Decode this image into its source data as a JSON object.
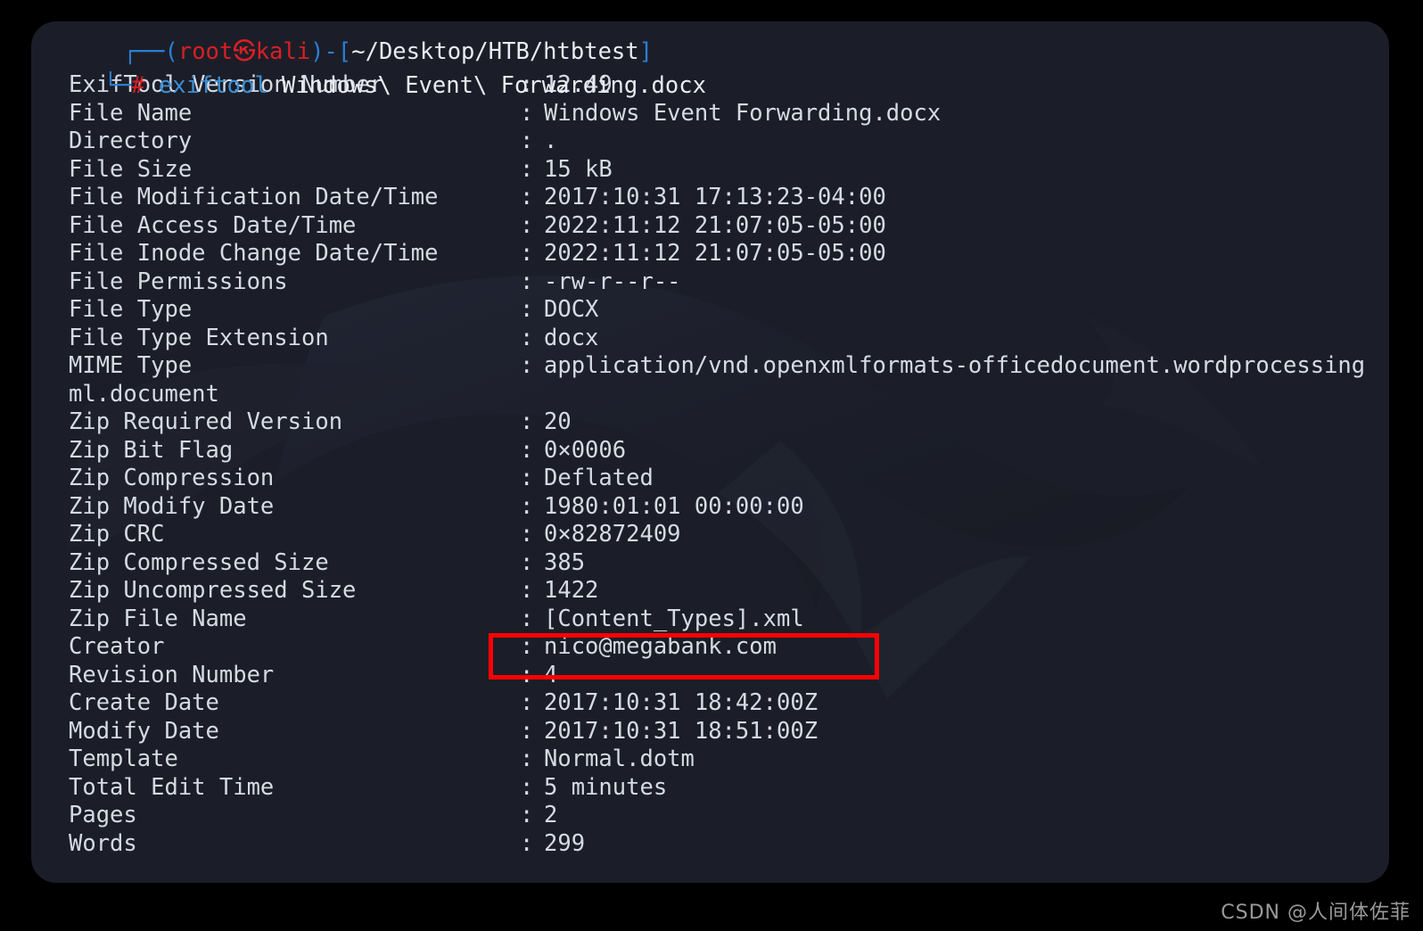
{
  "window": {
    "background_color": "#1b1e28",
    "page_background_color": "#000000",
    "text_color": "#d6dae3",
    "accent_red": "#fe0000",
    "prompt_red": "#d81f25",
    "prompt_blue": "#2a7fd4"
  },
  "prompt": {
    "clipped_line": "┌──(root㉿kali)-[~/Desktop/HTB/htbtest]",
    "user_host": "root㉿kali",
    "path": "~/Desktop/HTB/htbtest",
    "connector": "└─",
    "symbol": "#",
    "command_name": "exiftool",
    "command_args": "Windows\\ Event\\ Forwarding.docx",
    "full_command": "exiftool Windows\\ Event\\ Forwarding.docx"
  },
  "output": {
    "separator": ":",
    "rows": [
      {
        "key": "ExifTool Version Number",
        "value": "12.49"
      },
      {
        "key": "File Name",
        "value": "Windows Event Forwarding.docx"
      },
      {
        "key": "Directory",
        "value": "."
      },
      {
        "key": "File Size",
        "value": "15 kB"
      },
      {
        "key": "File Modification Date/Time",
        "value": "2017:10:31 17:13:23-04:00"
      },
      {
        "key": "File Access Date/Time",
        "value": "2022:11:12 21:07:05-05:00"
      },
      {
        "key": "File Inode Change Date/Time",
        "value": "2022:11:12 21:07:05-05:00"
      },
      {
        "key": "File Permissions",
        "value": "-rw-r--r--"
      },
      {
        "key": "File Type",
        "value": "DOCX"
      },
      {
        "key": "File Type Extension",
        "value": "docx"
      },
      {
        "key": "MIME Type",
        "value": "application/vnd.openxmlformats-officedocument.wordprocessing",
        "continuation": "ml.document"
      },
      {
        "key": "Zip Required Version",
        "value": "20"
      },
      {
        "key": "Zip Bit Flag",
        "value": "0×0006"
      },
      {
        "key": "Zip Compression",
        "value": "Deflated"
      },
      {
        "key": "Zip Modify Date",
        "value": "1980:01:01 00:00:00"
      },
      {
        "key": "Zip CRC",
        "value": "0×82872409"
      },
      {
        "key": "Zip Compressed Size",
        "value": "385"
      },
      {
        "key": "Zip Uncompressed Size",
        "value": "1422"
      },
      {
        "key": "Zip File Name",
        "value": "[Content_Types].xml"
      },
      {
        "key": "Creator",
        "value": "nico@megabank.com",
        "highlighted": true
      },
      {
        "key": "Revision Number",
        "value": "4",
        "highlighted": true
      },
      {
        "key": "Create Date",
        "value": "2017:10:31 18:42:00Z"
      },
      {
        "key": "Modify Date",
        "value": "2017:10:31 18:51:00Z"
      },
      {
        "key": "Template",
        "value": "Normal.dotm"
      },
      {
        "key": "Total Edit Time",
        "value": "5 minutes"
      },
      {
        "key": "Pages",
        "value": "2"
      },
      {
        "key": "Words",
        "value": "299"
      }
    ]
  },
  "annotation": {
    "color": "#fe0000",
    "targets": [
      "Creator",
      "Revision Number"
    ]
  },
  "watermark": {
    "text": "CSDN @人间体佐菲"
  }
}
